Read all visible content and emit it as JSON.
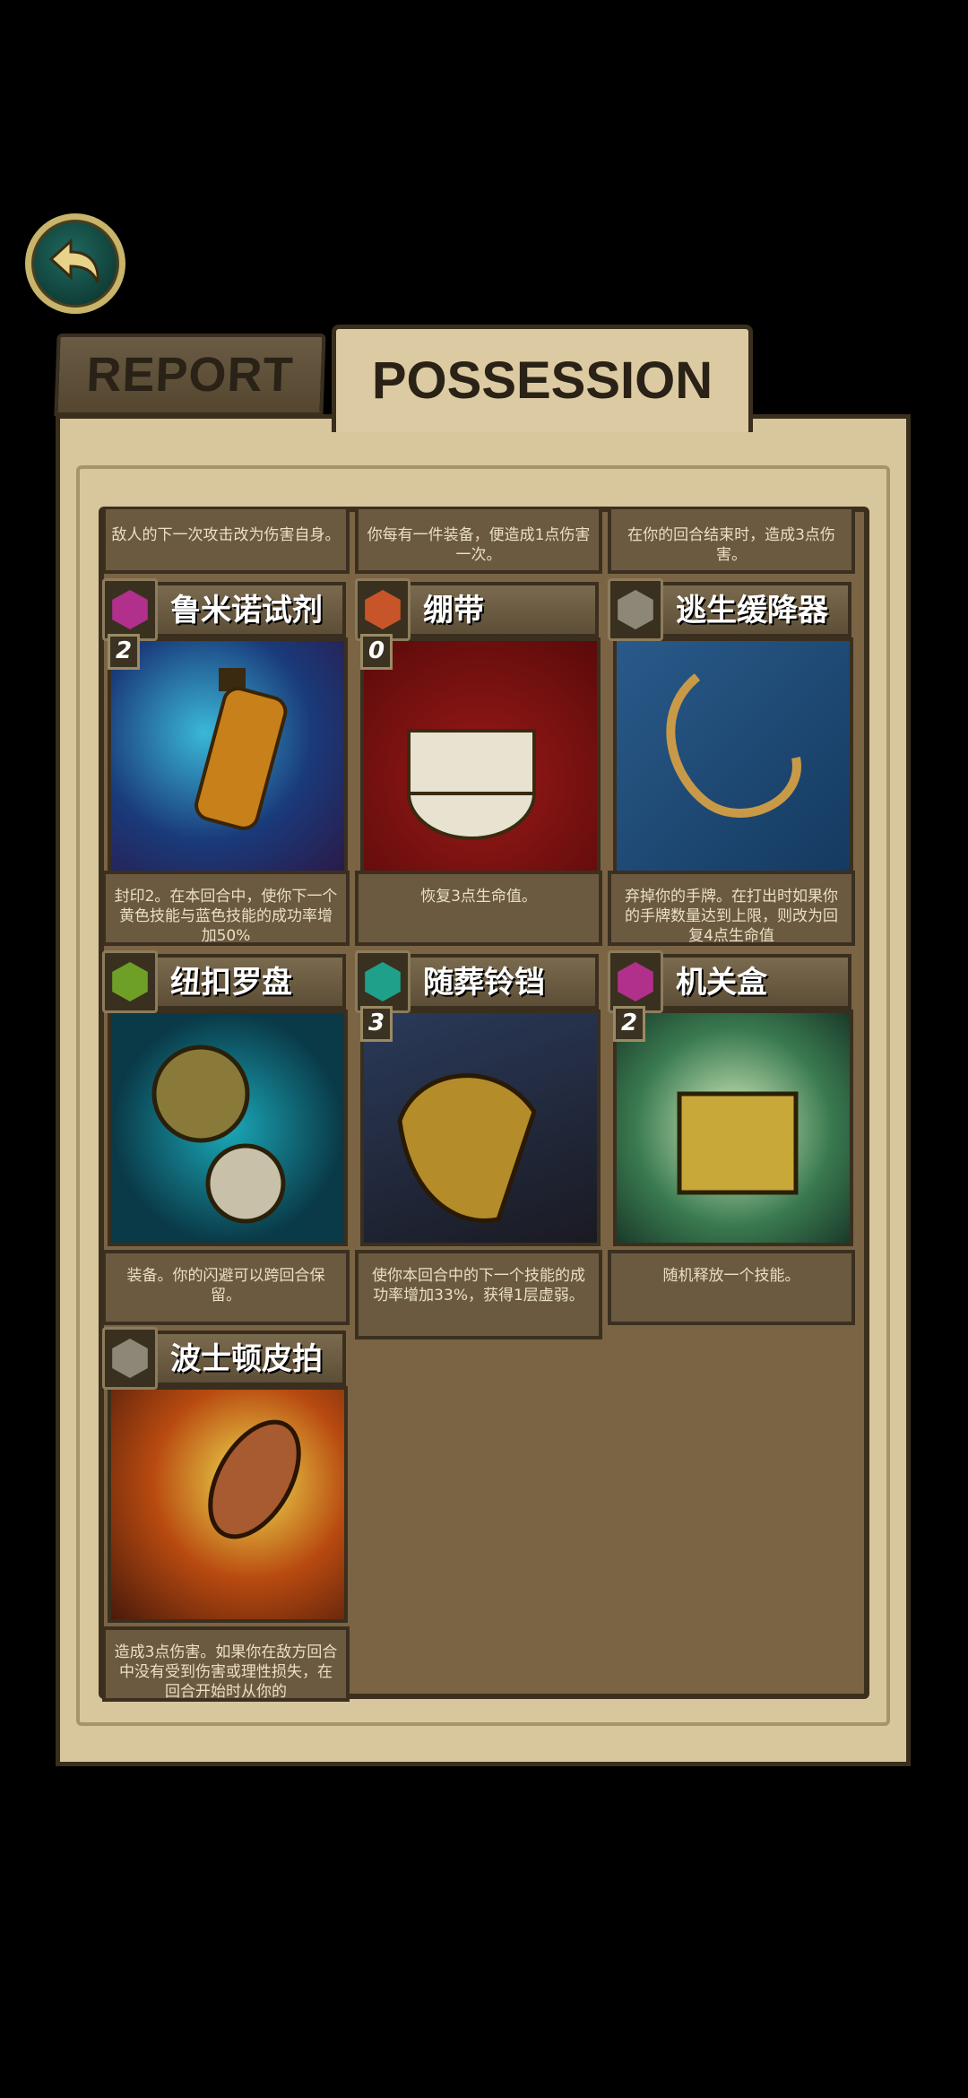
{
  "tabs": {
    "report": "REPORT",
    "possession": "POSSESSION"
  },
  "top_row": [
    {
      "desc": "敌人的下一次攻击改为伤害自身。"
    },
    {
      "desc": "你每有一件装备，便造成1点伤害一次。"
    },
    {
      "desc": "在你的回合结束时，造成3点伤害。"
    }
  ],
  "cards": [
    {
      "name": "鲁米诺试剂",
      "cost": "2",
      "gem": "magenta-gem-icon",
      "gem_color": "#b0308c",
      "art": "luminol-spray-icon",
      "desc": "封印2。在本回合中，使你下一个黄色技能与蓝色技能的成功率增加50%"
    },
    {
      "name": "绷带",
      "cost": "0",
      "gem": "orange-gem-icon",
      "gem_color": "#c8552a",
      "art": "bandage-roll-icon",
      "desc": "恢复3点生命值。"
    },
    {
      "name": "逃生缓降器",
      "cost": "",
      "gem": "gray-gem-icon",
      "gem_color": "#8d8778",
      "art": "escape-rope-icon",
      "desc": "弃掉你的手牌。在打出时如果你的手牌数量达到上限，则改为回复4点生命值"
    },
    {
      "name": "纽扣罗盘",
      "cost": "",
      "gem": "green-gem-icon",
      "gem_color": "#6ea028",
      "art": "button-compass-icon",
      "desc": "装备。你的闪避可以跨回合保留。"
    },
    {
      "name": "随葬铃铛",
      "cost": "3",
      "gem": "teal-gem-icon",
      "gem_color": "#1fa08a",
      "art": "funeral-bell-icon",
      "desc": "使你本回合中的下一个技能的成功率增加33%，获得1层虚弱。"
    },
    {
      "name": "机关盒",
      "cost": "2",
      "gem": "magenta-gem-icon",
      "gem_color": "#b0308c",
      "art": "puzzle-box-icon",
      "desc": "随机释放一个技能。"
    },
    {
      "name": "波士顿皮拍",
      "cost": "",
      "gem": "gray-gem-icon",
      "gem_color": "#8d8778",
      "art": "leather-slapper-icon",
      "desc": "造成3点伤害。如果你在敌方回合中没有受到伤害或理性损失，在回合开始时从你的"
    }
  ]
}
